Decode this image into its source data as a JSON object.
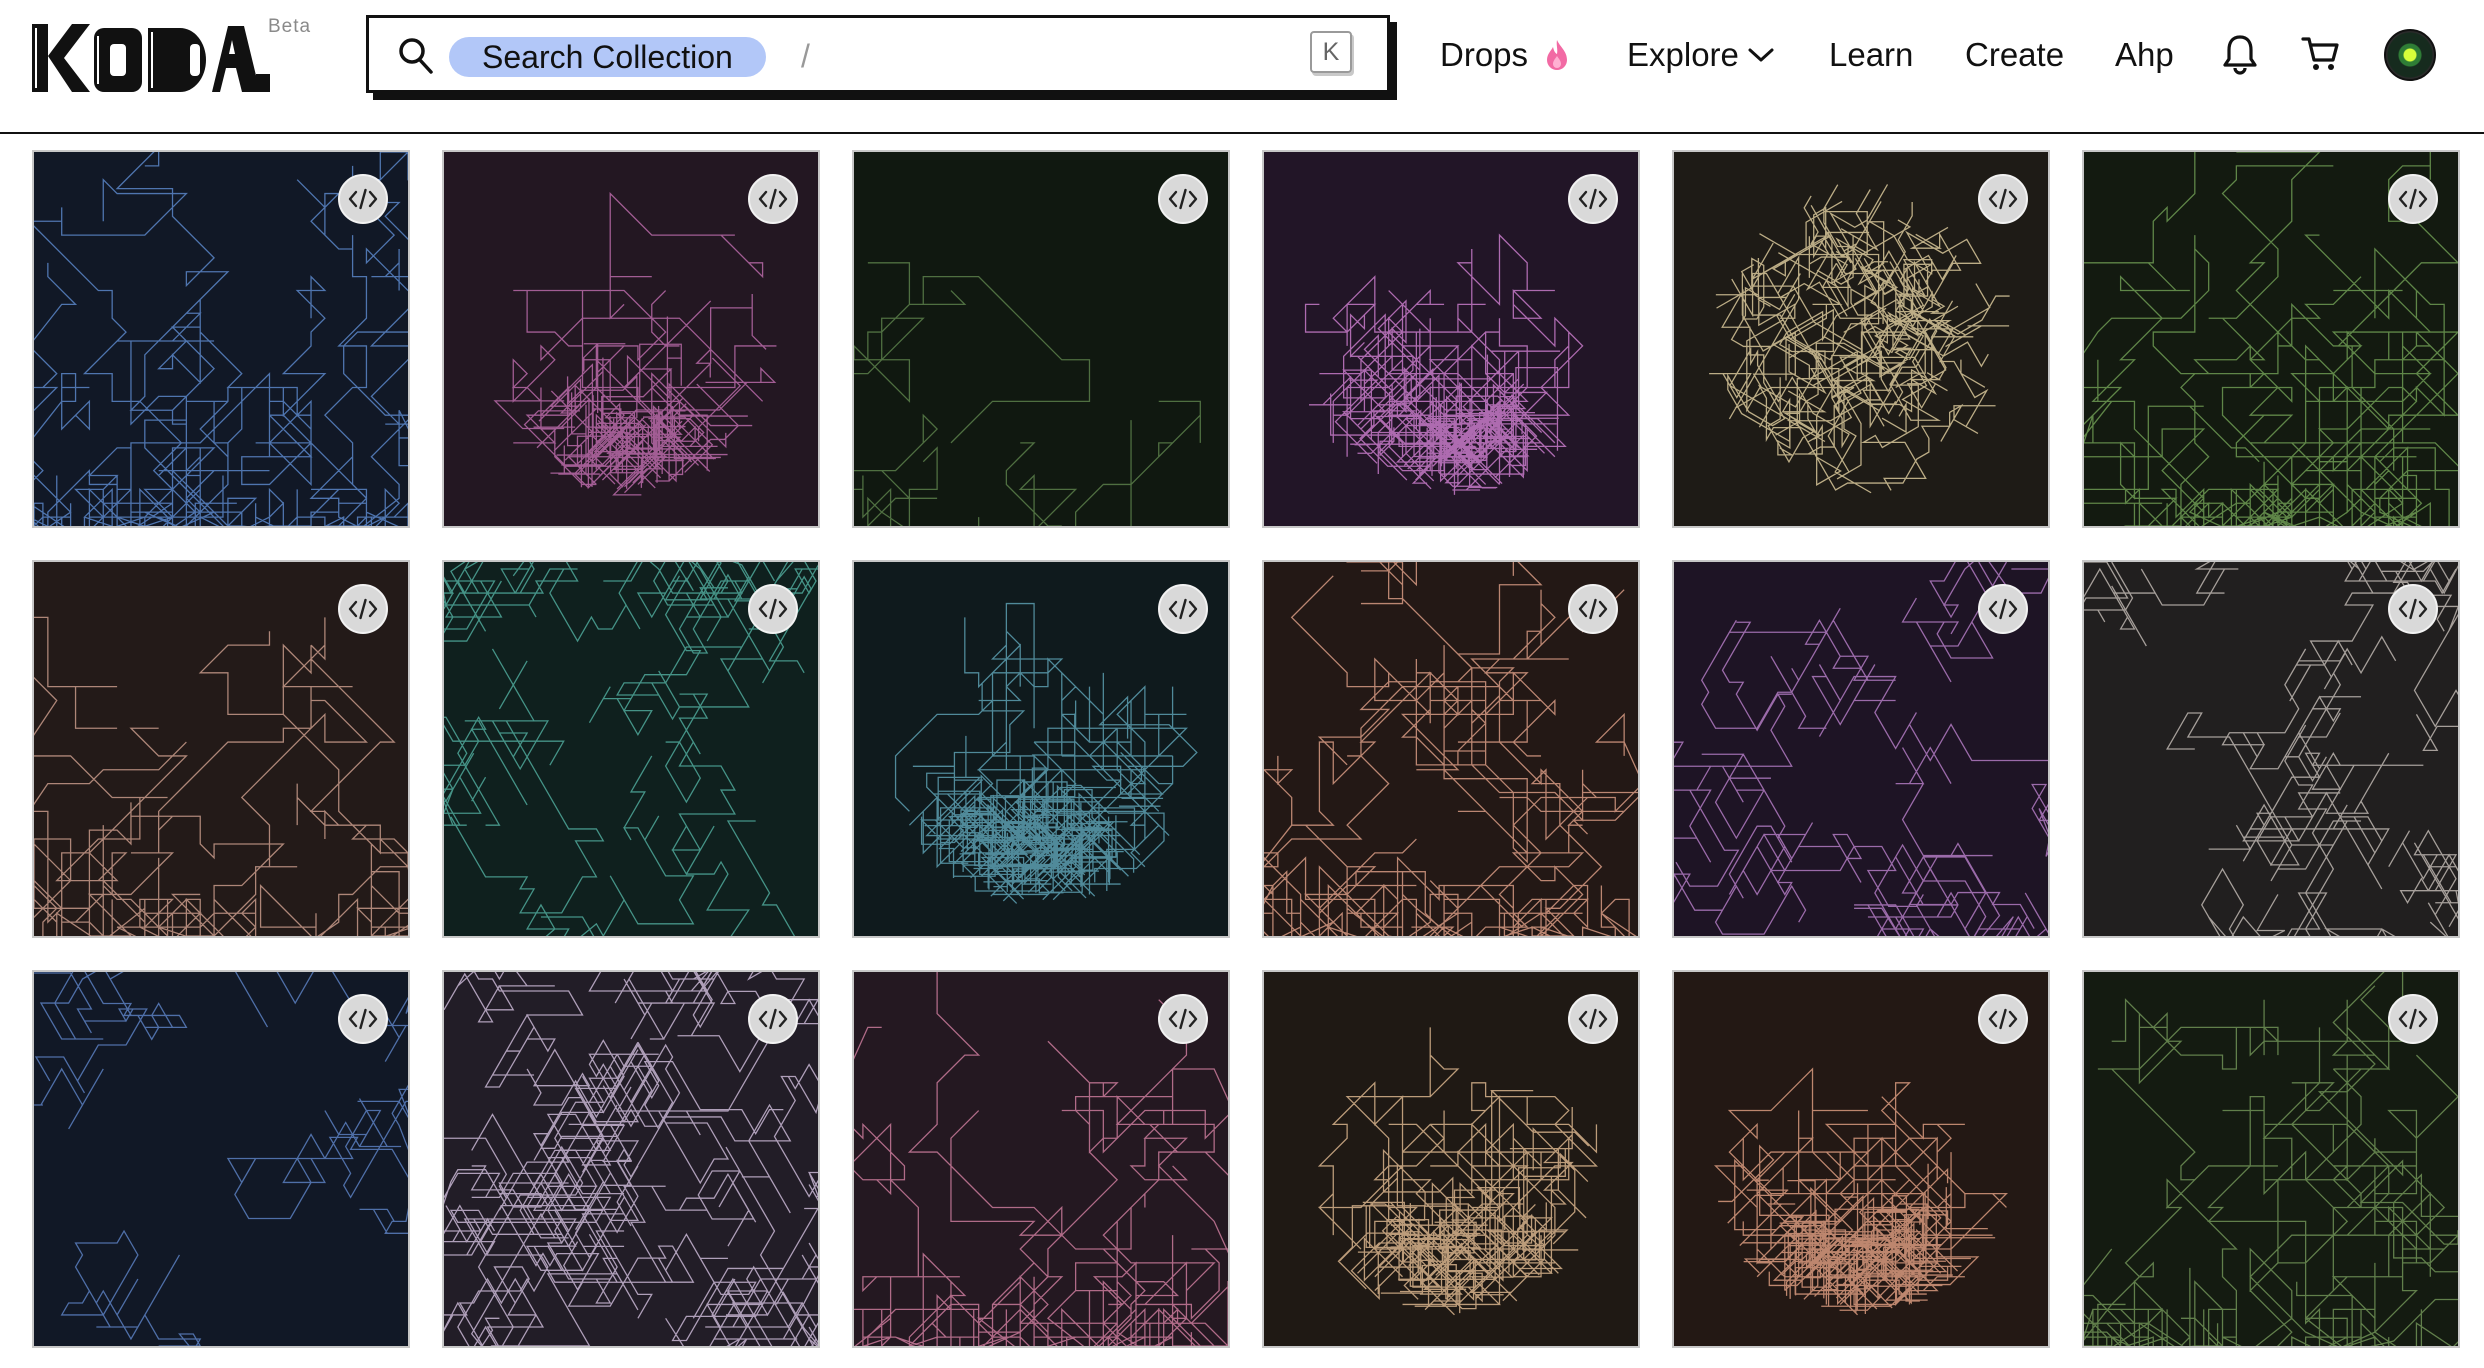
{
  "brand": {
    "logo_text": "KODA",
    "beta_label": "Beta"
  },
  "search": {
    "pill_label": "Search Collection",
    "separator": "/",
    "shortcut_key": "K"
  },
  "nav": {
    "drops_label": "Drops",
    "explore_label": "Explore",
    "learn_label": "Learn",
    "create_label": "Create",
    "network_label": "Ahp"
  },
  "icons": {
    "search": "search-icon",
    "drops": "flame-icon",
    "explore": "chevron-down-icon",
    "notifications": "bell-icon",
    "cart": "cart-icon",
    "tile_action": "code-icon"
  },
  "colors": {
    "accent_pill": "#b2c7f8",
    "flame": "#f26aa4"
  },
  "tiles": [
    {
      "bg": "#111826",
      "stroke": "#5b86c8",
      "style": "ortho",
      "density": 60,
      "spread": "wide",
      "seed": 11
    },
    {
      "bg": "#231722",
      "stroke": "#b86aa8",
      "style": "ortho",
      "density": 45,
      "spread": "center",
      "seed": 23
    },
    {
      "bg": "#101810",
      "stroke": "#5b7f4a",
      "style": "ortho",
      "density": 10,
      "spread": "wide",
      "seed": 7
    },
    {
      "bg": "#221527",
      "stroke": "#c77ac9",
      "style": "ortho",
      "density": 70,
      "spread": "center",
      "seed": 41
    },
    {
      "bg": "#1e1b16",
      "stroke": "#d8c79a",
      "style": "radial",
      "density": 60,
      "spread": "center",
      "seed": 55
    },
    {
      "bg": "#131a10",
      "stroke": "#6d9a52",
      "style": "ortho",
      "density": 70,
      "spread": "wide",
      "seed": 63
    },
    {
      "bg": "#231a18",
      "stroke": "#c79a8a",
      "style": "ortho",
      "density": 45,
      "spread": "wide",
      "seed": 71
    },
    {
      "bg": "#0f201e",
      "stroke": "#4fa89a",
      "style": "iso",
      "density": 40,
      "spread": "wide",
      "seed": 83
    },
    {
      "bg": "#0f1a1d",
      "stroke": "#5c9fb0",
      "style": "ortho",
      "density": 75,
      "spread": "center",
      "seed": 97
    },
    {
      "bg": "#231815",
      "stroke": "#d69a82",
      "style": "ortho",
      "density": 65,
      "spread": "wide",
      "seed": 101
    },
    {
      "bg": "#1e1425",
      "stroke": "#b27ac2",
      "style": "iso",
      "density": 35,
      "spread": "wide",
      "seed": 113
    },
    {
      "bg": "#211f1f",
      "stroke": "#bdb6b0",
      "style": "iso",
      "density": 35,
      "spread": "wide",
      "seed": 127
    },
    {
      "bg": "#111826",
      "stroke": "#5a7fbf",
      "style": "iso",
      "density": 18,
      "spread": "wide",
      "seed": 131
    },
    {
      "bg": "#221d27",
      "stroke": "#c8b6d4",
      "style": "iso",
      "density": 80,
      "spread": "wide",
      "seed": 149
    },
    {
      "bg": "#241821",
      "stroke": "#c97a9a",
      "style": "ortho",
      "density": 55,
      "spread": "wide",
      "seed": 157
    },
    {
      "bg": "#1f1914",
      "stroke": "#d8b48c",
      "style": "ortho",
      "density": 60,
      "spread": "center",
      "seed": 163
    },
    {
      "bg": "#231814",
      "stroke": "#d89a7e",
      "style": "ortho",
      "density": 75,
      "spread": "center",
      "seed": 173
    },
    {
      "bg": "#141b11",
      "stroke": "#6f9156",
      "style": "ortho",
      "density": 60,
      "spread": "wide",
      "seed": 181
    }
  ]
}
